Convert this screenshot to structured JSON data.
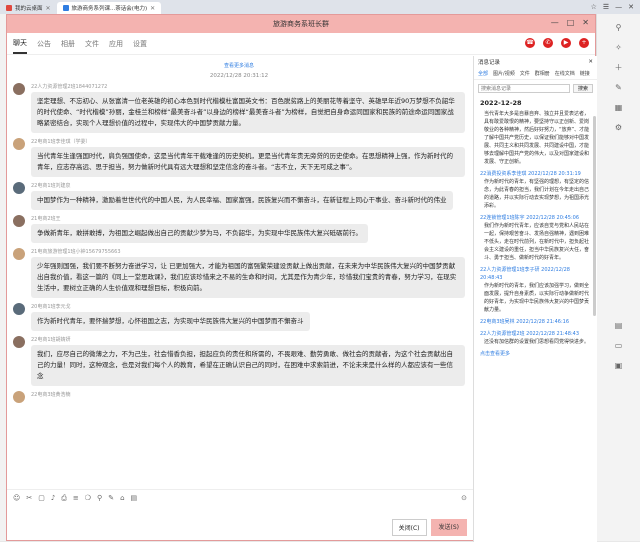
{
  "browser": {
    "tabs": [
      {
        "label": "我的云桌面",
        "active": false
      },
      {
        "label": "旅游商务系列课...茶话会(电力)",
        "active": true
      }
    ],
    "controls": [
      "☆",
      "☰",
      "—",
      "✕"
    ]
  },
  "window": {
    "title": "旅游商务系班长群",
    "controls": [
      "—",
      "□",
      "✕"
    ]
  },
  "nav": {
    "tabs": [
      "聊天",
      "公告",
      "相册",
      "文件",
      "应用",
      "设置"
    ],
    "active": "聊天"
  },
  "chat": {
    "top_badge": "查看更多消息",
    "timestamp": "2022/12/28 20:31:12",
    "messages": [
      {
        "sender": "22人力资源管理2班1844071272",
        "text": "坚定理想、不忘初心、从张富清一位老英雄的初心本色到时代楷模杜富国英文书：百色脱贫路上的美丽花等着坚守、英雄早年近90万梦想不负韶华的时代使命、“时代楷模”孙丽，金桂兰和榜样“最美奋斗者”以身边的榜样“最美奋斗者”为榜样，自觉把自身命运同国家和民族的前途命运同国家战略紧密结合，实现个人理想价值的过程中，实现伟大的中国梦贡献力量。"
      },
      {
        "sender": "22电商1班李佳琪（学委）",
        "text": "当代青年生逢强国时代，肩负强国使命，这是当代青年干载难逢的历史契机，更是当代青年责无旁贷的历史使命。在思想精神上强，作为新时代的青年，应志存高远、思于担当，努力做新时代具有远大理想和坚定信念的奋斗者。“志不立，天下无可成之事”。"
      },
      {
        "sender": "22电商1班刘建泉",
        "text": "中国梦作为一种精神，激励着世世代代的中国人民，为人民幸福、国家富强，民族复兴而不懈奋斗，在新征程上同心干事业、奋斗新时代的伟业"
      },
      {
        "sender": "21电商2班王",
        "text": "争做新青年，敢拼敢搏，为祖国之崛起做出自己的贡献少梦为马，不负韶华，为实现中华民族伟大复兴砥砺前行。"
      },
      {
        "sender": "21电商旅游管理1班小钟15679755663",
        "text": "少年强则国强，我们要不断努力奋进学习，让 已更加强大，才能为祖国的富强繁荣建设贡献上做出贡献，在未来为中华民族伟大复兴的中国梦贡献出自我价值，看这一篇的《同上一堂思政课》，我们应该珍惜来之不易的生命和时间，尤其是作为青少年，珍惜我们宝贵的青春，努力学习，在现实生活中，要树立正确的人生价值观和理想目标，积极向前。"
      },
      {
        "sender": "20电商1班李元戈",
        "text": "作为新时代青年，要怀揣梦想，心怀祖国之志，为实现中华民族伟大复兴的中国梦而不懈奋斗"
      },
      {
        "sender": "22电商1班胡婧妍",
        "text": "我们，应尽自己的微薄之力，不为己生，社会惜香负担，担起应负的责任和所需的，不畏艰难、勤劳勇敢、做社会的贡献者，为这个社会贡献出自己的力量！同时，这种观念，也是对我们每个人的教育，希望在正确认识自己的同时，在困难中求索前进，不论未来是什么样的人都应该有一些信念"
      },
      {
        "sender": "22电商3班黄浩楠",
        "text": ""
      }
    ]
  },
  "composer": {
    "tools": [
      "☺",
      "✂",
      "▢",
      "♪",
      "⎙",
      "≡",
      "❍",
      "⚲",
      "✎",
      "⌂",
      "▤"
    ],
    "close_label": "关闭(C)",
    "send_label": "发送(S)"
  },
  "side": {
    "header": "消息记录",
    "tabs": [
      "全部",
      "图片/视频",
      "文件",
      "群相册",
      "在线文档",
      "链接"
    ],
    "active_tab": "全部",
    "search_placeholder": "搜索消息记录",
    "search_label": "搜索",
    "date": "2022-12-28",
    "records": [
      {
        "meta": "",
        "text": "当代青年大多是自暴自弃、独立并且爱表达者，具有敢爱敢恨的精神，要坚持守以正创新、爱岗敬业的各种精神，然后好好努力，“放弃”、才能了解中国共产党历史，以保证我们能够对中国发展、共同主义和共同发展、共同建设中国，才能够去理解中国共产党的伟大，以及对国家建设和发展、守正创新。"
      },
      {
        "meta": "22消费投资系李佳琪 2022/12/28 20:31:19",
        "text": "作为新时代的青年，有坚强的理想，有坚定的信念，为此青春的担当，我们计划在今年走出自己的道路，并以实际行动去实现梦想，为祖国添光添彩。"
      },
      {
        "meta": "22连锁管理1班陈宇 2022/12/28 20:45:06",
        "text": "我们作为新时代青年，应该自觉与党和人民站在一起，保持艰苦奋斗、发扬自强精神，遇到困难不低头，走在时代前列，在新时代中，担负起社会主义建设的重任，担当中华民族复兴大任，奋斗、勇于担当、做新时代的好青年。"
      },
      {
        "meta": "22人力资源管理1班李子研 2022/12/28 20:48:43",
        "text": "作为新时代的青年，我们应该加强学习，做到全面发展，提升自身素质，以实际行动争做新时代的好青年，为实现中华民族伟大复兴的中国梦贡献力量。"
      },
      {
        "meta": "22电商3班吴林 2022/12/28 21:46:16",
        "text": ""
      },
      {
        "meta": "22人力资源管理2班 2022/12/28 21:48:43",
        "text": "还没有加信群的设置我们思想看同党得快进步。"
      }
    ],
    "footer_link": "点击查看更多"
  }
}
